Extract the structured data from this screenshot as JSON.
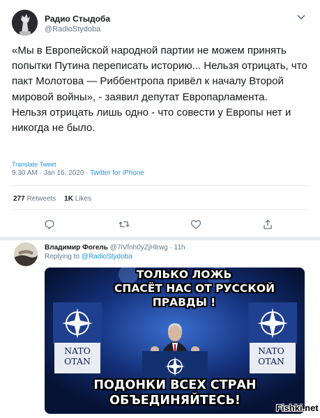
{
  "author": {
    "name": "Радио Стыдоба",
    "handle": "@RadioStydoba"
  },
  "tweet": {
    "lines": [
      "«Мы в Европейской народной партии не можем принять попытки Путина переписать историю... Нельзя отрицать, что пакт Молотова — Риббентропа привёл к началу Второй мировой войны», - заявил депутат Европарламента.",
      "Нельзя отрицать лишь одно - что совести у Европы нет и никогда не было."
    ],
    "translate_label": "Translate Tweet",
    "time": "9:30 AM · Jan 16, 2020 ·",
    "source": "Twitter for iPhone"
  },
  "stats": {
    "retweets_count": "277",
    "retweets_label": "Retweets",
    "likes_count": "1K",
    "likes_label": "Likes"
  },
  "actions": [
    "reply-icon",
    "retweet-icon",
    "like-icon",
    "share-icon"
  ],
  "reply": {
    "name": "Владимир Фогель",
    "handle_time": "@7iVfnh0yZjHlrwg · 11h",
    "replying_prefix": "Replying to",
    "replying_to": "@RadioStydoba",
    "meme": {
      "top_lines": [
        "ТОЛЬКО ЛОЖЬ",
        "СПАСЁТ НАС ОТ РУССКОЙ",
        "ПРАВДЫ !"
      ],
      "bottom_lines": [
        "ПОДОНКИ ВСЕХ СТРАН",
        "ОБЪЕДИНЯЙТЕСЬ!"
      ],
      "sign_left": [
        "NATO",
        "OTAN"
      ],
      "sign_right": [
        "NATO",
        "OTAN"
      ]
    }
  },
  "watermark": "Fishki.net",
  "colors": {
    "link": "#1b95e0",
    "muted": "#657786",
    "text": "#14171a",
    "nato_blue": "#0b1e58"
  }
}
